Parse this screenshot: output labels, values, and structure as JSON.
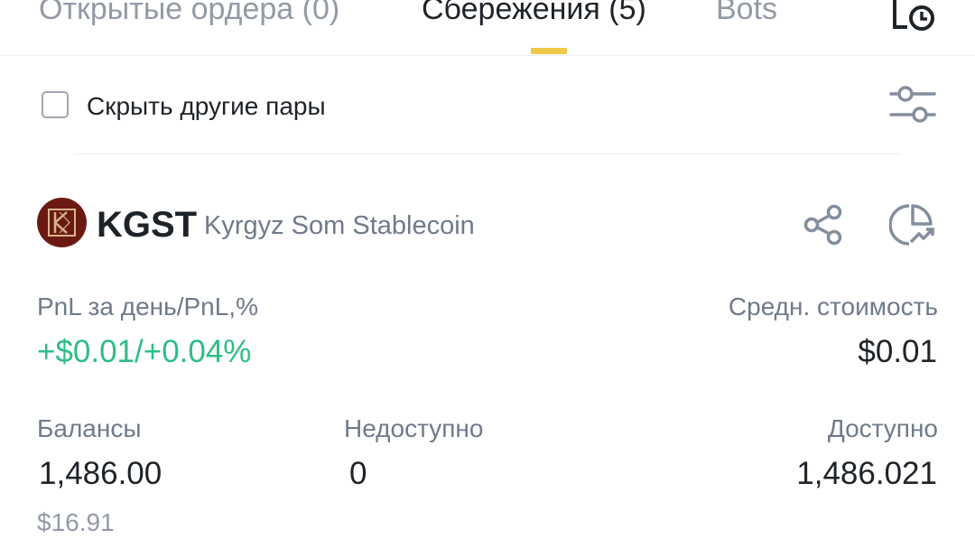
{
  "tabs": [
    {
      "label": "Открытые ордера (0)",
      "active": false
    },
    {
      "label": "Сбережения (5)",
      "active": true
    },
    {
      "label": "Bots",
      "active": false
    }
  ],
  "filter": {
    "hide_other_pairs_label": "Скрыть другие пары",
    "hide_other_pairs_checked": false
  },
  "asset": {
    "ticker": "KGST",
    "name": "Kyrgyz Som Stablecoin",
    "logo_letter": "K"
  },
  "pnl": {
    "label": "PnL за день/PnL,%",
    "value": "+$0.01/+0.04%"
  },
  "avg_cost": {
    "label": "Средн. стоимость",
    "value": "$0.01"
  },
  "balances": {
    "label": "Балансы",
    "value": "1,486.00",
    "usd_value": "$16.91"
  },
  "unavailable": {
    "label": "Недоступно",
    "value": "0"
  },
  "available": {
    "label": "Доступно",
    "value": "1,486.021"
  },
  "colors": {
    "accent_yellow": "#f0c94a",
    "positive_green": "#2ebd85",
    "text_primary": "#1e2329",
    "text_secondary": "#707a8a",
    "logo_bg": "#6b1a12"
  },
  "icons": {
    "history": "order-history-icon",
    "filter": "filter-sliders-icon",
    "share": "share-icon",
    "analysis": "pie-chart-trend-icon"
  }
}
